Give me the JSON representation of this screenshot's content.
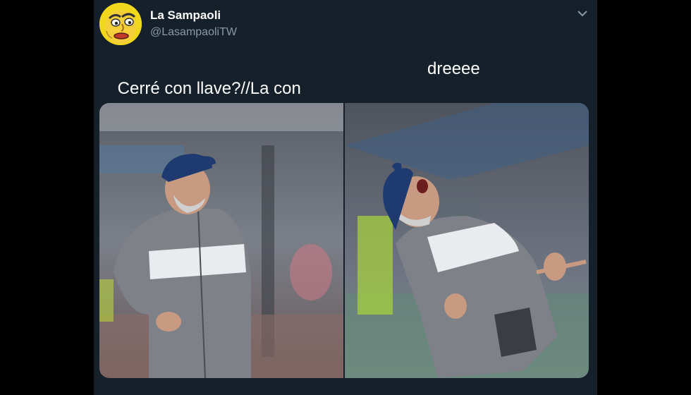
{
  "tweet": {
    "display_name": "La Sampaoli",
    "handle": "@LasampaoliTW",
    "text_part1": "Cerré con llave?//La con",
    "text_part2": "dreeee",
    "menu_icon": "chevron-down-icon",
    "avatar_icon": "cartoon-face-avatar"
  },
  "colors": {
    "background": "#15202b",
    "page_border": "#000000",
    "name": "#ffffff",
    "handle": "#8899a6"
  },
  "media": {
    "photos": [
      {
        "id": "left-photo",
        "subject": "man in blue cap and grey jacket looking up"
      },
      {
        "id": "right-photo",
        "subject": "man in blue cap leaning back shouting upward"
      }
    ]
  }
}
